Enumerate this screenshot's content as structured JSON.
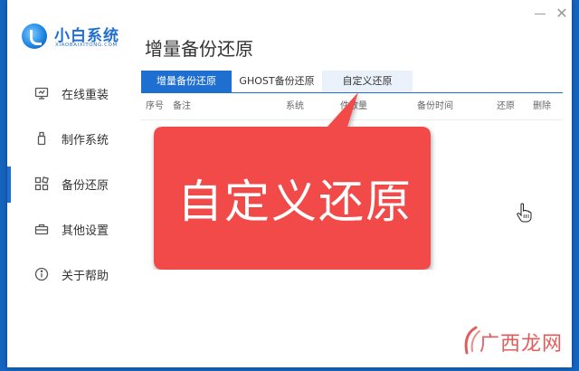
{
  "app": {
    "logo_title": "小白系统",
    "logo_subtitle": "XIAOBAIXITONG.COM"
  },
  "sidebar": {
    "items": [
      {
        "label": "在线重装",
        "icon": "monitor-icon"
      },
      {
        "label": "制作系统",
        "icon": "usb-icon"
      },
      {
        "label": "备份还原",
        "icon": "grid-icon",
        "active": true
      },
      {
        "label": "其他设置",
        "icon": "briefcase-icon"
      },
      {
        "label": "关于帮助",
        "icon": "info-icon"
      }
    ]
  },
  "main": {
    "title": "增量备份还原",
    "tabs": [
      {
        "label": "增量备份还原",
        "active": true
      },
      {
        "label": "GHOST备份还原"
      },
      {
        "label": "自定义还原"
      }
    ],
    "table": {
      "columns": [
        "序号",
        "备注",
        "系统",
        "件数量",
        "备份时间",
        "还原",
        "删除"
      ]
    }
  },
  "callout": {
    "text": "自定义还原",
    "color": "#f24848"
  },
  "watermark": {
    "text": "广西龙网"
  },
  "colors": {
    "accent": "#1f6fd0",
    "background": "#1565c0"
  }
}
